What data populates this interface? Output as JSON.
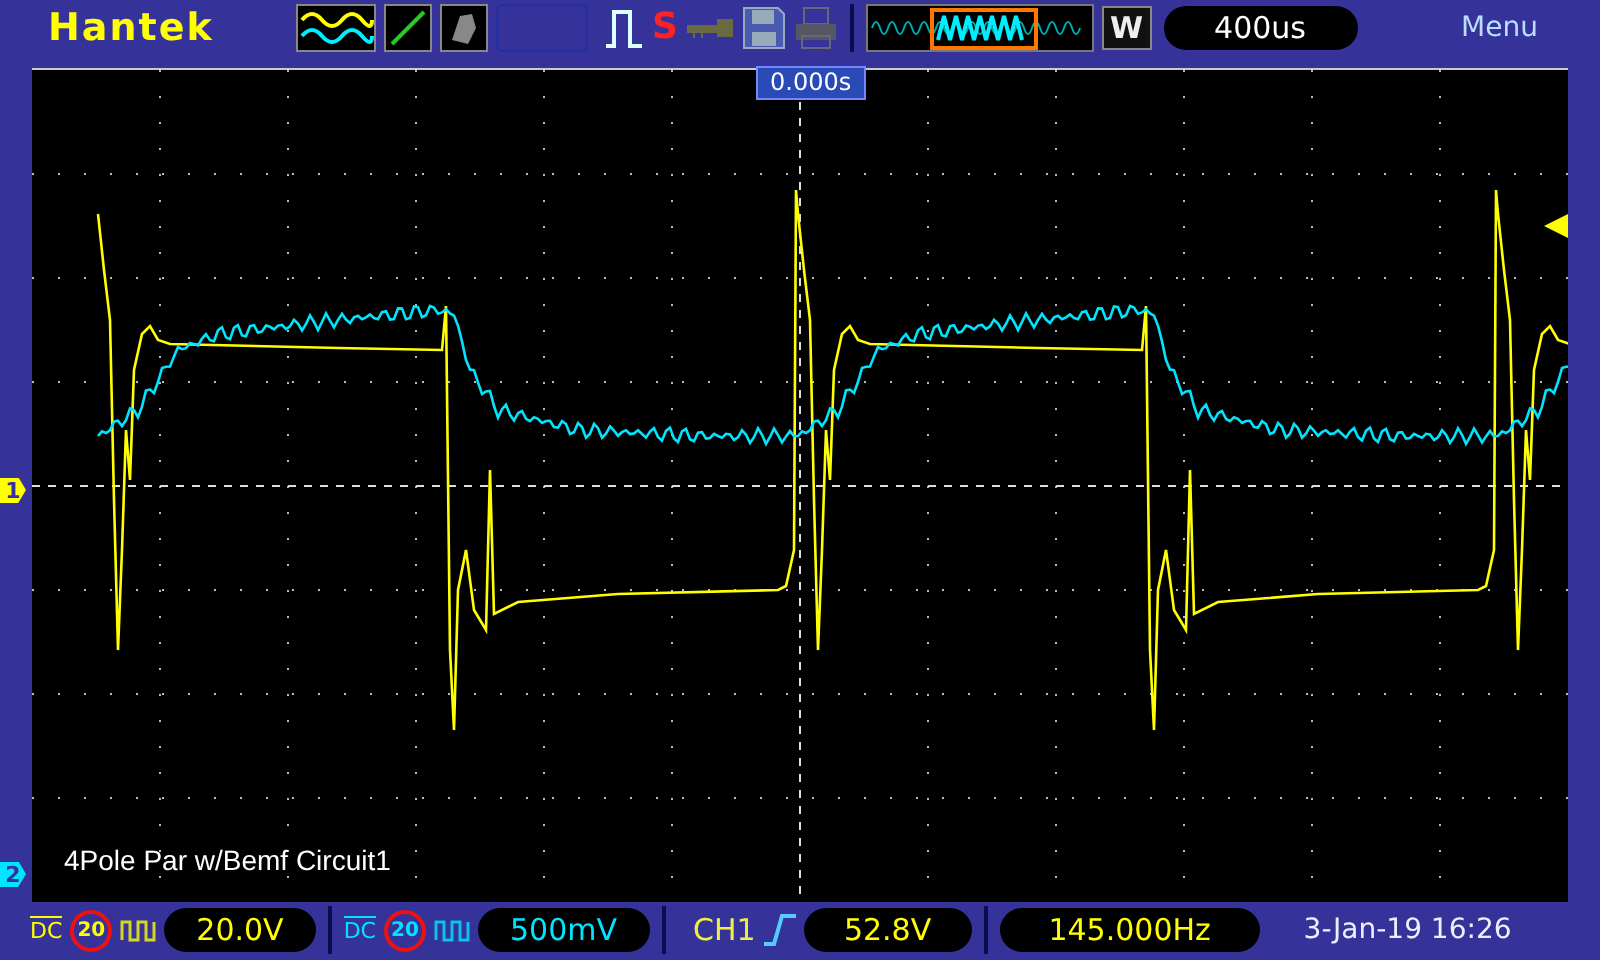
{
  "brand": "Hantek",
  "run_state": "S",
  "window_label": "W",
  "timebase": "400us",
  "menu": "Menu",
  "trigger_time": "0.000s",
  "waveform_label": "4Pole Par w/Bemf Circuit1",
  "channels": [
    {
      "marker": "1",
      "coupling": "DC",
      "bandwidth": "20",
      "scale": "20.0V",
      "color": "#ffff00"
    },
    {
      "marker": "2",
      "coupling": "DC",
      "bandwidth": "20",
      "scale": "500mV",
      "color": "#00e5ff"
    }
  ],
  "trigger": {
    "source": "CH1",
    "level": "52.8V"
  },
  "frequency": "145.000Hz",
  "datetime": "3-Jan-19 16:26"
}
